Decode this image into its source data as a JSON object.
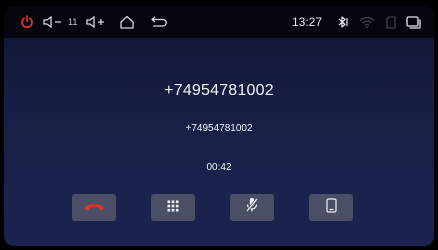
{
  "status_bar": {
    "icons": [
      "power-icon",
      "volume-down-icon",
      "volume-up-icon",
      "home-icon",
      "back-icon"
    ],
    "volume_level": "11",
    "time": "13:27",
    "right_icons": [
      "bluetooth-icon",
      "wifi-icon",
      "sd-card-icon",
      "recent-apps-icon"
    ],
    "power_color": "#e8372c"
  },
  "call": {
    "caller_number": "+74954781002",
    "caller_detail": "+74954781002",
    "duration": "00:42"
  },
  "controls": [
    {
      "name": "hangup-button",
      "icon": "phone-hangup-icon",
      "color": "#e03528"
    },
    {
      "name": "keypad-button",
      "icon": "dialpad-icon"
    },
    {
      "name": "mute-button",
      "icon": "mic-mute-icon"
    },
    {
      "name": "handset-button",
      "icon": "phone-device-icon"
    }
  ]
}
